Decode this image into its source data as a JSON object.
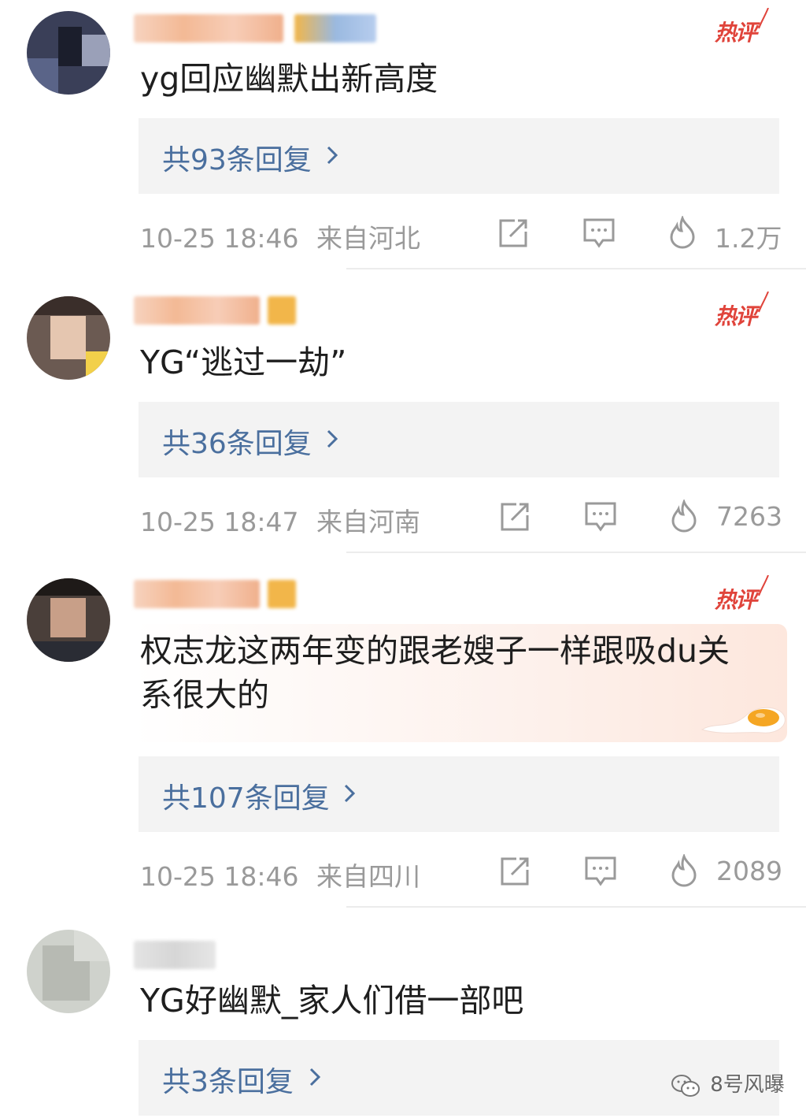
{
  "hot_label": "热评",
  "watermark": "8号风曝",
  "comments": [
    {
      "text": "yg回应幽默出新高度",
      "replies": "共93条回复",
      "time": "10-25 18:46",
      "location": "来自河北",
      "likes": "1.2万",
      "hot": true
    },
    {
      "text": "YG“逃过一劫”",
      "replies": "共36条回复",
      "time": "10-25 18:47",
      "location": "来自河南",
      "likes": "7263",
      "hot": true
    },
    {
      "text": "权志龙这两年变的跟老嫂子一样跟吸du关系很大的",
      "replies": "共107条回复",
      "time": "10-25 18:46",
      "location": "来自四川",
      "likes": "2089",
      "hot": true
    },
    {
      "text": "YG好幽默_家人们借一部吧",
      "replies": "共3条回复",
      "hot": false
    }
  ],
  "icons": {
    "share": "share-icon",
    "comment": "comment-icon",
    "like": "like-flame-icon",
    "chevron": "chevron-right-icon"
  },
  "colors": {
    "hot": "#e0443b",
    "reply_link": "#4a6f9e",
    "meta": "#9a9a9a"
  }
}
